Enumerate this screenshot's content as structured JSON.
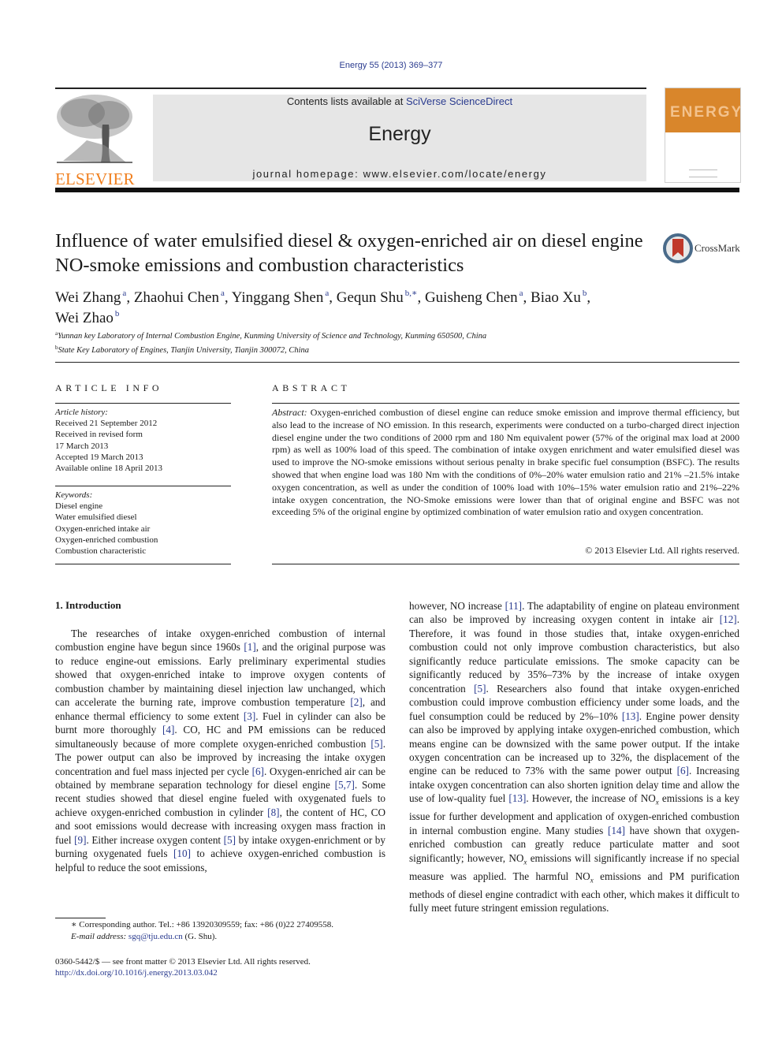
{
  "header": {
    "citation": "Energy 55 (2013) 369–377",
    "contents_prefix": "Contents lists available at ",
    "contents_link": "SciVerse ScienceDirect",
    "journal_name": "Energy",
    "homepage_prefix": "journal homepage: ",
    "homepage_url": "www.elsevier.com/locate/energy",
    "publisher_logo": "ELSEVIER",
    "cover_title": "ENERGY",
    "crossmark_label": "CrossMark",
    "brand_orange": "#f07f1e",
    "link_blue": "#2a3b8f"
  },
  "article": {
    "title": "Influence of water emulsified diesel & oxygen-enriched air on diesel engine NO-smoke emissions and combustion characteristics",
    "authors": [
      {
        "name": "Wei Zhang",
        "aff": "a"
      },
      {
        "name": "Zhaohui Chen",
        "aff": "a"
      },
      {
        "name": "Yinggang Shen",
        "aff": "a"
      },
      {
        "name": "Gequn Shu",
        "aff": "b,∗"
      },
      {
        "name": "Guisheng Chen",
        "aff": "a"
      },
      {
        "name": "Biao Xu",
        "aff": "b"
      },
      {
        "name": "Wei Zhao",
        "aff": "b"
      }
    ],
    "affiliations": [
      {
        "key": "a",
        "text": "Yunnan key Laboratory of Internal Combustion Engine, Kunming University of Science and Technology, Kunming 650500, China"
      },
      {
        "key": "b",
        "text": "State Key Laboratory of Engines, Tianjin University, Tianjin 300072, China"
      }
    ]
  },
  "article_info": {
    "heading": "ARTICLE INFO",
    "history_label": "Article history:",
    "history": [
      "Received 21 September 2012",
      "Received in revised form",
      "17 March 2013",
      "Accepted 19 March 2013",
      "Available online 18 April 2013"
    ],
    "keywords_label": "Keywords:",
    "keywords": [
      "Diesel engine",
      "Water emulsified diesel",
      "Oxygen-enriched intake air",
      "Oxygen-enriched combustion",
      "Combustion characteristic"
    ]
  },
  "abstract": {
    "heading": "ABSTRACT",
    "label": "Abstract:",
    "text": " Oxygen-enriched combustion of diesel engine can reduce smoke emission and improve thermal efficiency, but also lead to the increase of NO emission. In this research, experiments were conducted on a turbo-charged direct injection diesel engine under the two conditions of 2000 rpm and 180 Nm equivalent power (57% of the original max load at 2000 rpm) as well as 100% load of this speed. The combination of intake oxygen enrichment and water emulsified diesel was used to improve the NO-smoke emissions without serious penalty in brake specific fuel consumption (BSFC). The results showed that when engine load was 180 Nm with the conditions of 0%–20% water emulsion ratio and 21% –21.5% intake oxygen concentration, as well as under the condition of 100% load with 10%–15% water emulsion ratio and 21%–22% intake oxygen concentration, the NO-Smoke emissions were lower than that of original engine and BSFC was not exceeding 5% of the original engine by optimized combination of water emulsion ratio and oxygen concentration.",
    "copyright": "© 2013 Elsevier Ltd. All rights reserved."
  },
  "body": {
    "section_heading": "1.  Introduction",
    "left_segments": [
      {
        "t": "The researches of intake oxygen-enriched combustion of internal combustion engine have begun since 1960s "
      },
      {
        "r": "[1]"
      },
      {
        "t": ", and the original purpose was to reduce engine-out emissions. Early preliminary experimental studies showed that oxygen-enriched intake to improve oxygen contents of combustion chamber by maintaining diesel injection law unchanged, which can accelerate the burning rate, improve combustion temperature "
      },
      {
        "r": "[2]"
      },
      {
        "t": ", and enhance thermal efficiency to some extent "
      },
      {
        "r": "[3]"
      },
      {
        "t": ". Fuel in cylinder can also be burnt more thoroughly "
      },
      {
        "r": "[4]"
      },
      {
        "t": ". CO, HC and PM emissions can be reduced simultaneously because of more complete oxygen-enriched combustion "
      },
      {
        "r": "[5]"
      },
      {
        "t": ". The power output can also be improved by increasing the intake oxygen concentration and fuel mass injected per cycle "
      },
      {
        "r": "[6]"
      },
      {
        "t": ". Oxygen-enriched air can be obtained by membrane separation technology for diesel engine "
      },
      {
        "r": "[5,7]"
      },
      {
        "t": ". Some recent studies showed that diesel engine fueled with oxygenated fuels to achieve oxygen-enriched combustion in cylinder "
      },
      {
        "r": "[8]"
      },
      {
        "t": ", the content of HC, CO and soot emissions would decrease with increasing oxygen mass fraction in fuel "
      },
      {
        "r": "[9]"
      },
      {
        "t": ". Either increase oxygen content "
      },
      {
        "r": "[5]"
      },
      {
        "t": " by intake oxygen-enrichment or by burning oxygenated fuels "
      },
      {
        "r": "[10]"
      },
      {
        "t": " to achieve oxygen-enriched combustion is helpful to reduce the soot emissions,"
      }
    ],
    "right_segments": [
      {
        "t": "however, NO increase "
      },
      {
        "r": "[11]"
      },
      {
        "t": ". The adaptability of engine on plateau environment can also be improved by increasing oxygen content in intake air "
      },
      {
        "r": "[12]"
      },
      {
        "t": ". Therefore, it was found in those studies that, intake oxygen-enriched combustion could not only improve combustion characteristics, but also significantly reduce particulate emissions. The smoke capacity can be significantly reduced by 35%–73% by the increase of intake oxygen concentration "
      },
      {
        "r": "[5]"
      },
      {
        "t": ". Researchers also found that intake oxygen-enriched combustion could improve combustion efficiency under some loads, and the fuel consumption could be reduced by 2%–10% "
      },
      {
        "r": "[13]"
      },
      {
        "t": ". Engine power density can also be improved by applying intake oxygen-enriched combustion, which means engine can be downsized with the same power output. If the intake oxygen concentration can be increased up to 32%, the displacement of the engine can be reduced to 73% with the same power output "
      },
      {
        "r": "[6]"
      },
      {
        "t": ". Increasing intake oxygen concentration can also shorten ignition delay time and allow the use of low-quality fuel "
      },
      {
        "r": "[13]"
      },
      {
        "t": ". However, the increase of NO"
      },
      {
        "s": "x"
      },
      {
        "t": " emissions is a key issue for further development and application of oxygen-enriched combustion in internal combustion engine. Many studies "
      },
      {
        "r": "[14]"
      },
      {
        "t": " have shown that oxygen-enriched combustion can greatly reduce particulate matter and soot significantly; however, NO"
      },
      {
        "s": "x"
      },
      {
        "t": " emissions will significantly increase if no special measure was applied. The harmful NO"
      },
      {
        "s": "x"
      },
      {
        "t": " emissions and PM purification methods of diesel engine contradict with each other, which makes it difficult to fully meet future stringent emission regulations."
      }
    ]
  },
  "footnote": {
    "marker": "∗",
    "corresponding": " Corresponding author. Tel.: +86 13920309559; fax: +86 (0)22 27409558.",
    "email_label": "E-mail address: ",
    "email": "sgq@tju.edu.cn",
    "email_suffix": " (G. Shu)."
  },
  "front_matter": {
    "issn_line": "0360-5442/$ — see front matter © 2013 Elsevier Ltd. All rights reserved.",
    "doi": "http://dx.doi.org/10.1016/j.energy.2013.03.042"
  }
}
